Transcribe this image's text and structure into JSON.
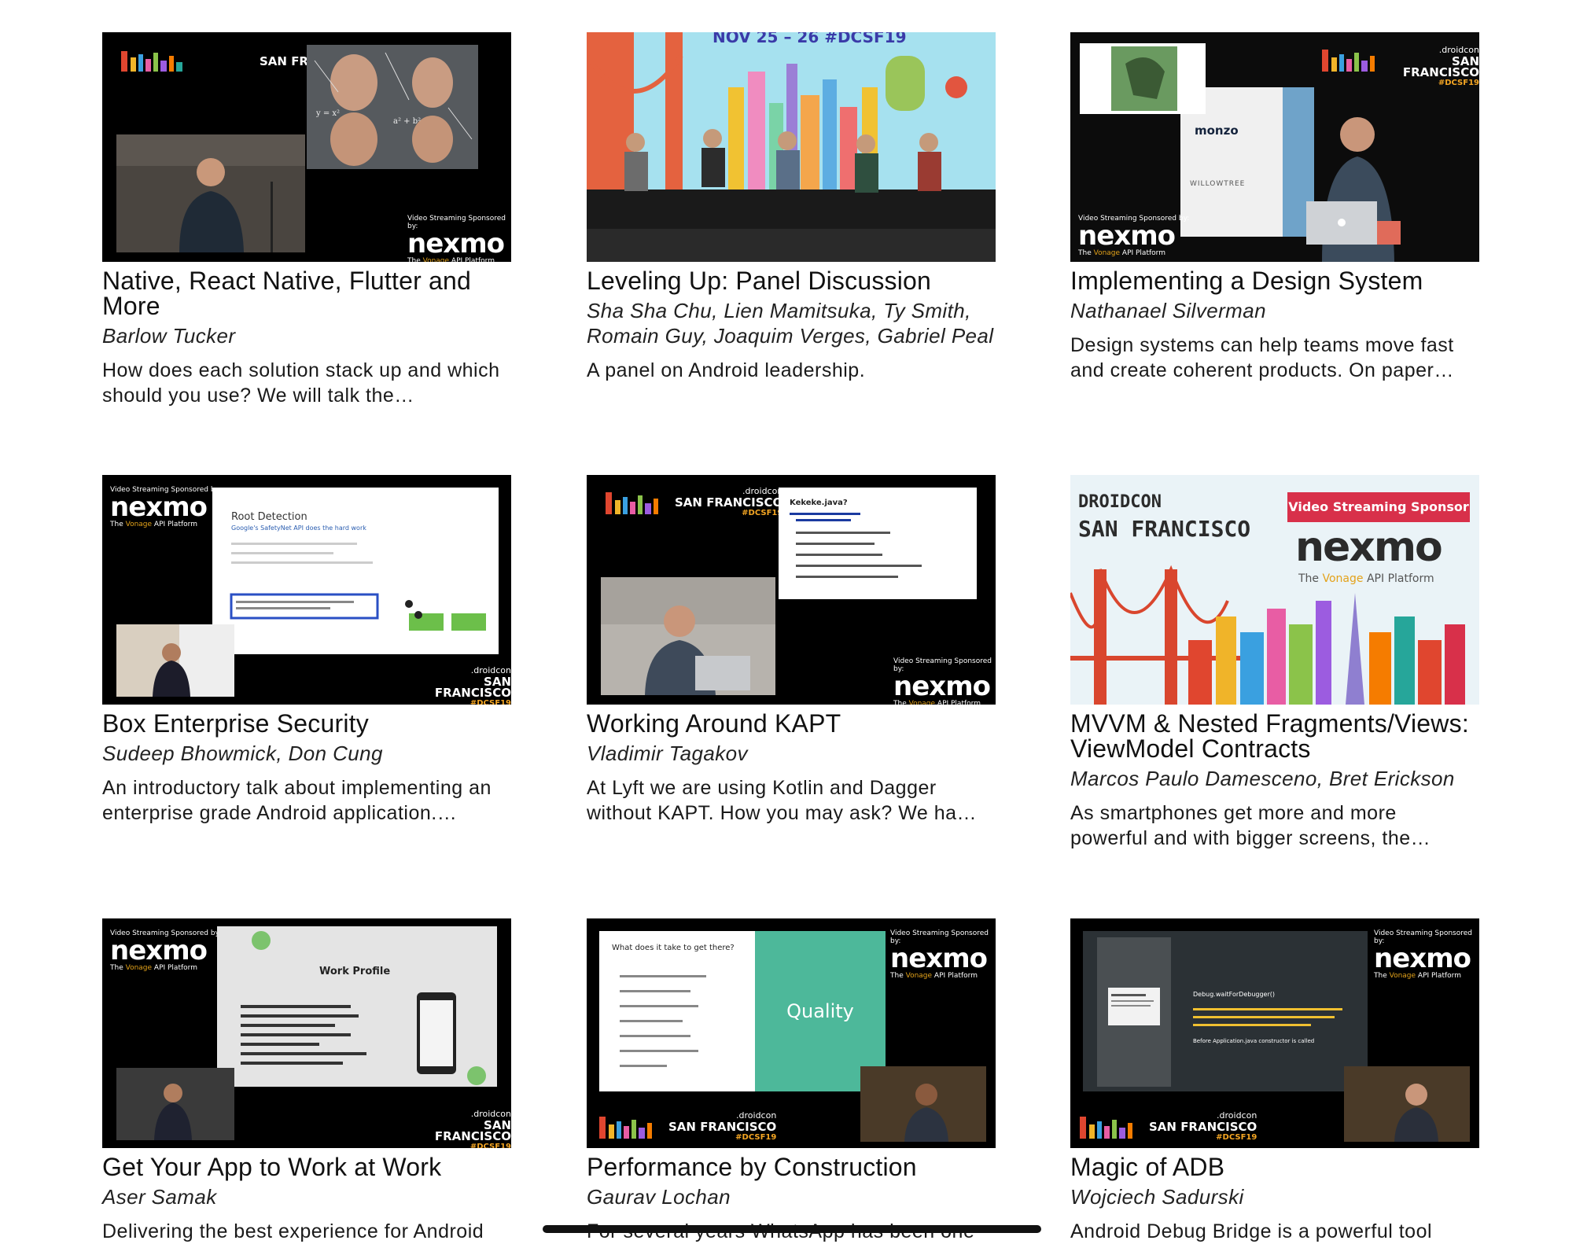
{
  "talks": [
    {
      "title": "Native, React Native, Flutter and More",
      "speakers": "Barlow Tucker",
      "description": "How does each solution stack up and which should you use? We will talk the…",
      "thumb": "stage-speaker-meme"
    },
    {
      "title": "Leveling Up: Panel Discussion",
      "speakers": "Sha Sha Chu, Lien Mamitsuka, Ty Smith, Romain Guy, Joaquim Verges, Gabriel Peal",
      "description": "A panel on Android leadership.",
      "thumb": "panel-stage",
      "banner": "NOV 25 – 26 #DCSF19"
    },
    {
      "title": "Implementing a Design System",
      "speakers": "Nathanael Silverman",
      "description": "Design systems can help teams move fast and create coherent products. On paper…",
      "thumb": "speaker-design",
      "banner_brands": [
        "monzo",
        "WILLOWTREE"
      ]
    },
    {
      "title": "Box Enterprise Security",
      "speakers": "Sudeep Bhowmick, Don Cung",
      "description": "An introductory talk about implementing an enterprise grade Android application.…",
      "thumb": "slide-root",
      "slide_title": "Root Detection",
      "slide_subtitle": "Google's SafetyNet API does the hard work"
    },
    {
      "title": "Working Around KAPT",
      "speakers": "Vladimir Tagakov",
      "description": "At Lyft we are using Kotlin and Dagger without KAPT. How you may ask? We ha…",
      "thumb": "slide-kekeke",
      "slide_title": "Kekeke.java?"
    },
    {
      "title": "MVVM & Nested Fragments/Views: ViewModel Contracts",
      "speakers": "Marcos Paulo Damesceno, Bret Erickson",
      "description": "As smartphones get more and more powerful and with bigger screens, the…",
      "thumb": "sponsor-card",
      "poster_line1": "DROIDCON",
      "poster_line2": "SAN FRANCISCO",
      "poster_badge": "Video Streaming Sponsor"
    },
    {
      "title": "Get Your App to Work at Work",
      "speakers": "Aser Samak",
      "description": "Delivering the best experience for Android",
      "thumb": "slide-workprofile",
      "slide_title": "Work Profile"
    },
    {
      "title": "Performance by Construction",
      "speakers": "Gaurav Lochan",
      "description": "For several years WhatsApp has been one",
      "thumb": "slide-quality",
      "slide_title": "What does it take to get there?",
      "slide_accent": "Quality"
    },
    {
      "title": "Magic of ADB",
      "speakers": "Wojciech Sadurski",
      "description": "Android Debug Bridge is a powerful tool",
      "thumb": "slide-adb",
      "slide_title": "Debug.waitForDebugger()",
      "slide_note": "Before Application.java constructor is called"
    }
  ],
  "branding": {
    "droidcon_top": ".droidcon",
    "droidcon_city": "SAN FRANCISCO",
    "droidcon_tag": "#DCSF19",
    "sponsor_label": "Video Streaming Sponsored by:",
    "sponsor_brand": "nexmo",
    "sponsor_platform_pre": "The ",
    "sponsor_platform_brand": "Vonage",
    "sponsor_platform_post": " API Platform"
  },
  "colors": {
    "text_primary": "#111111",
    "quality_green": "#4db89a",
    "poster_red": "#d8304a",
    "bridge_red": "#d9462e"
  }
}
